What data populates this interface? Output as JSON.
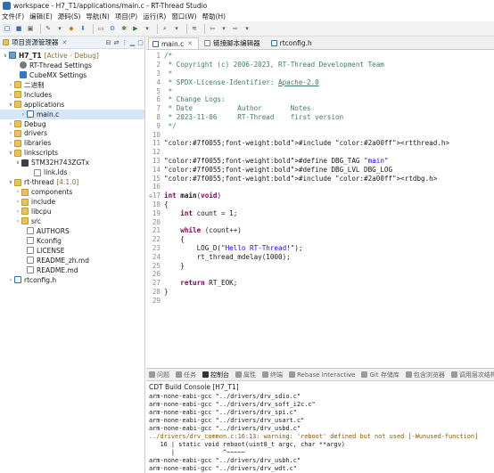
{
  "window": {
    "title": "workspace - H7_T1/applications/main.c - RT-Thread Studio"
  },
  "menu": [
    "文件(F)",
    "编辑(E)",
    "源码(S)",
    "导航(N)",
    "项目(P)",
    "运行(R)",
    "窗口(W)",
    "帮助(H)"
  ],
  "explorer": {
    "title": "项目资源管理器",
    "close": "✕",
    "project": {
      "name": "H7_T1",
      "status": "[Active - Debug]"
    },
    "items": [
      {
        "label": "RT-Thread Settings",
        "icon": "gear-icon"
      },
      {
        "label": "CubeMX Settings",
        "icon": "cube-icon"
      },
      {
        "label": "二进制",
        "icon": "folder-icon"
      },
      {
        "label": "Includes",
        "icon": "folder-icon"
      },
      {
        "label": "applications",
        "icon": "folder-icon"
      },
      {
        "label": "main.c",
        "icon": "c-file-icon"
      },
      {
        "label": "Debug",
        "icon": "folder-icon"
      },
      {
        "label": "drivers",
        "icon": "folder-icon"
      },
      {
        "label": "libraries",
        "icon": "folder-icon"
      },
      {
        "label": "linkscripts",
        "icon": "folder-icon"
      },
      {
        "label": "STM32H743ZGTx",
        "icon": "folder-icon"
      },
      {
        "label": "link.lds",
        "icon": "file-icon"
      },
      {
        "label": "rt-thread",
        "tag": "[4.1.0]",
        "icon": "folder-icon"
      },
      {
        "label": "components",
        "icon": "folder-icon"
      },
      {
        "label": "include",
        "icon": "folder-icon"
      },
      {
        "label": "libcpu",
        "icon": "folder-icon"
      },
      {
        "label": "src",
        "icon": "folder-icon"
      },
      {
        "label": "AUTHORS",
        "icon": "file-icon"
      },
      {
        "label": "Kconfig",
        "icon": "file-icon"
      },
      {
        "label": "LICENSE",
        "icon": "file-icon"
      },
      {
        "label": "README_zh.md",
        "icon": "file-icon"
      },
      {
        "label": "README.md",
        "icon": "file-icon"
      },
      {
        "label": "rtconfig.h",
        "icon": "c-file-icon"
      }
    ]
  },
  "editor": {
    "tabs": [
      {
        "label": "main.c",
        "close": "✕"
      },
      {
        "label": "链接脚本编辑器"
      },
      {
        "label": "rtconfig.h"
      }
    ],
    "lines": [
      {
        "n": "1",
        "text": "/*"
      },
      {
        "n": "2",
        "text": " * Copyright (c) 2006-2023, RT-Thread Development Team"
      },
      {
        "n": "3",
        "text": " *"
      },
      {
        "n": "4",
        "text": " * SPDX-License-Identifier: Apache-2.0"
      },
      {
        "n": "5",
        "text": " *"
      },
      {
        "n": "6",
        "text": " * Change Logs:"
      },
      {
        "n": "7",
        "text": " * Date           Author       Notes"
      },
      {
        "n": "8",
        "text": " * 2023-11-06     RT-Thread    first version"
      },
      {
        "n": "9",
        "text": " */"
      },
      {
        "n": "10",
        "text": ""
      },
      {
        "n": "11",
        "text": "#include <rtthread.h>"
      },
      {
        "n": "12",
        "text": ""
      },
      {
        "n": "13",
        "text": "#define DBG_TAG \"main\""
      },
      {
        "n": "14",
        "text": "#define DBG_LVL DBG_LOG"
      },
      {
        "n": "15",
        "text": "#include <rtdbg.h>"
      },
      {
        "n": "16",
        "text": ""
      },
      {
        "n": "17",
        "text": "int main(void)"
      },
      {
        "n": "18",
        "text": "{"
      },
      {
        "n": "19",
        "text": "    int count = 1;"
      },
      {
        "n": "20",
        "text": ""
      },
      {
        "n": "21",
        "text": "    while (count++)"
      },
      {
        "n": "22",
        "text": "    {"
      },
      {
        "n": "23",
        "text": "        LOG_D(\"Hello RT-Thread!\");"
      },
      {
        "n": "24",
        "text": "        rt_thread_mdelay(1000);"
      },
      {
        "n": "25",
        "text": "    }"
      },
      {
        "n": "26",
        "text": ""
      },
      {
        "n": "27",
        "text": "    return RT_EOK;"
      },
      {
        "n": "28",
        "text": "}"
      },
      {
        "n": "29",
        "text": ""
      }
    ]
  },
  "bottom": {
    "tabs": [
      "问题",
      "任务",
      "控制台",
      "属性",
      "终端",
      "Rebase Interactive",
      "Git 存储库",
      "包含浏览器",
      "调用层次结构"
    ],
    "console_title": "CDT Build Console [H7_T1]",
    "console_lines": [
      "arm-none-eabi-gcc \"../drivers/drv_sdio.c\"",
      "arm-none-eabi-gcc \"../drivers/drv_soft_i2c.c\"",
      "arm-none-eabi-gcc \"../drivers/drv_spi.c\"",
      "arm-none-eabi-gcc \"../drivers/drv_usart.c\"",
      "arm-none-eabi-gcc \"../drivers/drv_usbd.c\"",
      "../drivers/drv_common.c:16:13: warning: 'reboot' defined but not used [-Wunused-function]",
      "   16 | static void reboot(uint8_t argc, char **argv)",
      "      |             ^~~~~~",
      "arm-none-eabi-gcc \"../drivers/drv_usbh.c\"",
      "arm-none-eabi-gcc \"../drivers/drv_wdt.c\"",
      "arm-none-eabi-gcc \"../applications/main.c\""
    ]
  },
  "colors": {
    "comment": "#3f7f5f",
    "keyword": "#7f0055",
    "string": "#2a00ff",
    "preproc": "#7f0055",
    "include_path": "#2a00ff",
    "warning_text": "#8a5a00",
    "console_text": "#000000"
  }
}
